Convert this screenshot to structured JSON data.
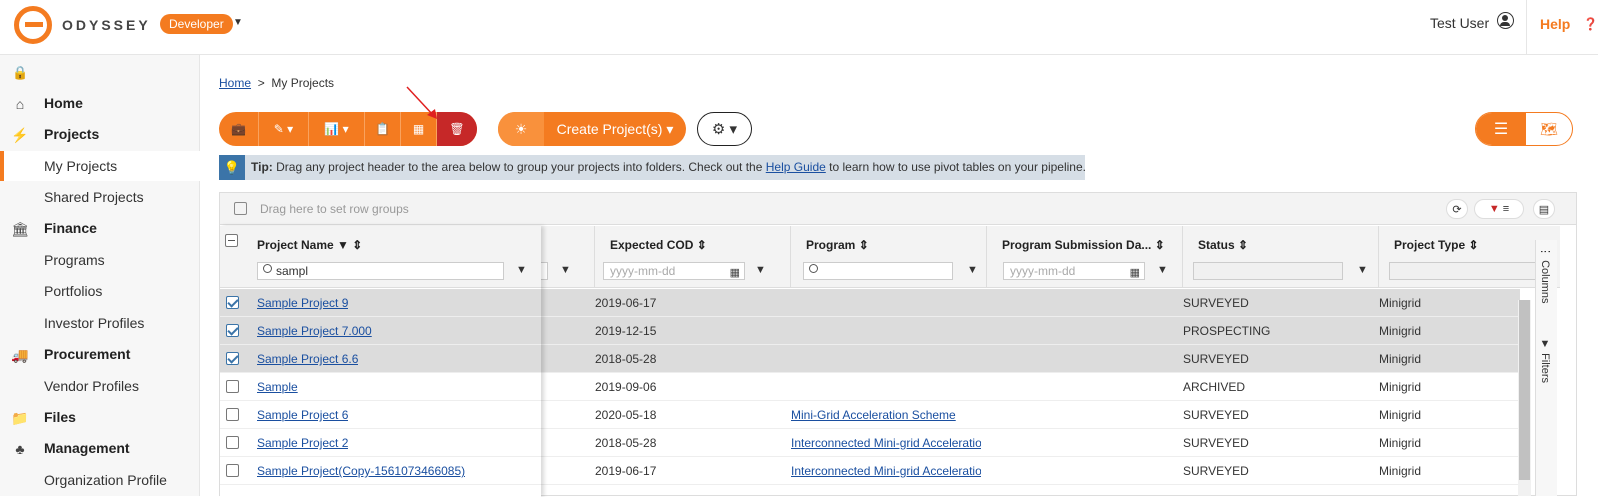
{
  "header": {
    "brand": "ODYSSEY",
    "role": "Developer",
    "user": "Test User",
    "help": "Help"
  },
  "sidebar": {
    "sections": [
      {
        "label": "Home",
        "icon": "home-icon"
      },
      {
        "label": "Projects",
        "icon": "projects-icon",
        "items": [
          "My Projects",
          "Shared Projects"
        ]
      },
      {
        "label": "Finance",
        "icon": "bank-icon",
        "items": [
          "Programs",
          "Portfolios",
          "Investor Profiles"
        ]
      },
      {
        "label": "Procurement",
        "icon": "truck-icon",
        "items": [
          "Vendor Profiles"
        ]
      },
      {
        "label": "Files",
        "icon": "folder-icon"
      },
      {
        "label": "Management",
        "icon": "org-chart-icon",
        "items": [
          "Organization Profile"
        ]
      }
    ],
    "active": "My Projects"
  },
  "breadcrumb": {
    "home": "Home",
    "sep": ">",
    "current": "My Projects"
  },
  "toolbar": {
    "create_label": "Create Project(s)"
  },
  "tip": {
    "label": "Tip:",
    "text1": "Drag any project header to the area below to group your projects into folders. Check out the",
    "link": "Help Guide",
    "text2": "to learn how to use pivot tables on your pipeline."
  },
  "grid": {
    "group_hint": "Drag here to set row groups",
    "columns": [
      {
        "title": "Project Name",
        "filter": "sampl"
      },
      {
        "title": "Expected COD",
        "placeholder": "yyyy-mm-dd"
      },
      {
        "title": "Program",
        "filter": ""
      },
      {
        "title": "Program Submission Da...",
        "placeholder": "yyyy-mm-dd"
      },
      {
        "title": "Status"
      },
      {
        "title": "Project Type"
      }
    ],
    "rows": [
      {
        "selected": true,
        "name": "Sample Project 9",
        "cod": "2019-06-17",
        "program": "",
        "status": "SURVEYED",
        "type": "Minigrid"
      },
      {
        "selected": true,
        "name": "Sample Project 7.000",
        "cod": "2019-12-15",
        "program": "",
        "status": "PROSPECTING",
        "type": "Minigrid"
      },
      {
        "selected": true,
        "name": "Sample Project 6.6",
        "cod": "2018-05-28",
        "program": "",
        "status": "SURVEYED",
        "type": "Minigrid"
      },
      {
        "selected": false,
        "name": "Sample",
        "cod": "2019-09-06",
        "program": "",
        "status": "ARCHIVED",
        "type": "Minigrid"
      },
      {
        "selected": false,
        "name": "Sample Project 6",
        "cod": "2020-05-18",
        "program": "Mini-Grid Acceleration Scheme",
        "status": "SURVEYED",
        "type": "Minigrid"
      },
      {
        "selected": false,
        "name": "Sample Project 2",
        "cod": "2018-05-28",
        "program": "Interconnected Mini-grid Acceleratio",
        "status": "SURVEYED",
        "type": "Minigrid"
      },
      {
        "selected": false,
        "name": "Sample Project(Copy-1561073466085)",
        "cod": "2019-06-17",
        "program": "Interconnected Mini-grid Acceleratio",
        "status": "SURVEYED",
        "type": "Minigrid"
      }
    ],
    "side_tabs": [
      "Columns",
      "Filters"
    ]
  },
  "colors": {
    "accent": "#f47b20",
    "danger": "#c62828",
    "tip_bg": "#d6dee6",
    "link": "#1a4fa0"
  }
}
